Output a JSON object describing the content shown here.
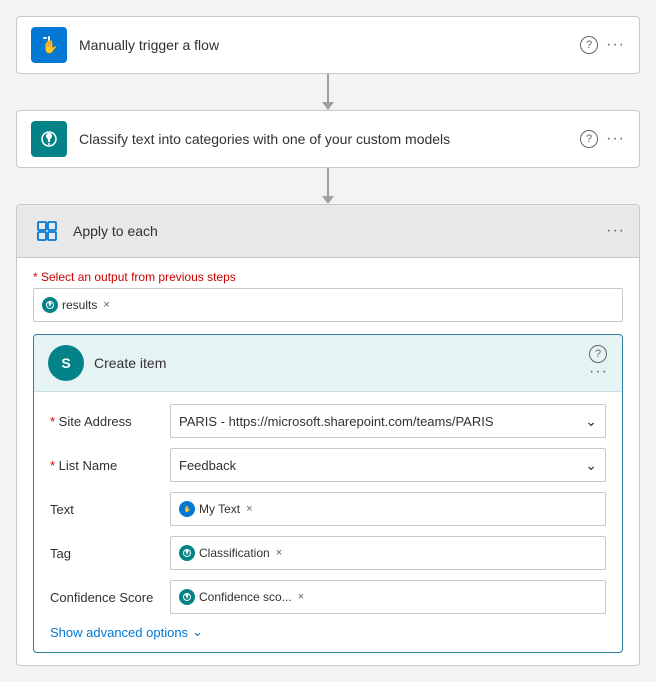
{
  "steps": [
    {
      "id": "manually-trigger",
      "label": "Manually trigger a flow",
      "iconType": "blue",
      "iconShape": "hand"
    },
    {
      "id": "classify-text",
      "label": "Classify text into categories with one of your custom models",
      "iconType": "teal",
      "iconShape": "brain"
    }
  ],
  "applyEach": {
    "title": "Apply to each",
    "selectOutputLabel": "* Select an output from previous steps",
    "token": {
      "label": "results",
      "type": "teal"
    }
  },
  "createItem": {
    "avatarLetter": "S",
    "title": "Create item",
    "fields": [
      {
        "id": "site-address",
        "label": "Site Address",
        "required": true,
        "type": "dropdown",
        "value": "PARIS - https://microsoft.sharepoint.com/teams/PARIS"
      },
      {
        "id": "list-name",
        "label": "List Name",
        "required": true,
        "type": "dropdown",
        "value": "Feedback"
      },
      {
        "id": "text",
        "label": "Text",
        "required": false,
        "type": "token",
        "tokens": [
          {
            "label": "My Text",
            "iconType": "blue",
            "hasX": true
          }
        ]
      },
      {
        "id": "tag",
        "label": "Tag",
        "required": false,
        "type": "token",
        "tokens": [
          {
            "label": "Classification",
            "iconType": "teal",
            "hasX": true
          }
        ]
      },
      {
        "id": "confidence-score",
        "label": "Confidence Score",
        "required": false,
        "type": "token",
        "tokens": [
          {
            "label": "Confidence sco...",
            "iconType": "teal",
            "hasX": true
          }
        ]
      }
    ],
    "showAdvancedLabel": "Show advanced options"
  },
  "ui": {
    "helpLabel": "?",
    "moreLabel": "···",
    "chevronDown": "∨",
    "xLabel": "×"
  }
}
